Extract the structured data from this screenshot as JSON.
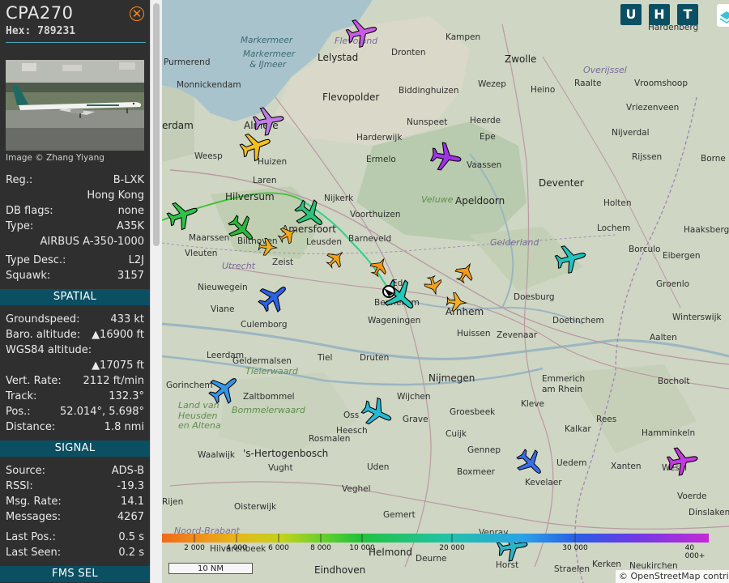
{
  "aircraft": {
    "callsign": "CPA270",
    "hex_label": "Hex:",
    "hex": "789231",
    "image_credit": "Image © Zhang Yiyang"
  },
  "details": [
    {
      "label": "Reg.:",
      "value": "B-LXK"
    },
    {
      "label": "",
      "value": "Hong Kong"
    },
    {
      "label": "DB flags:",
      "value": "none"
    },
    {
      "label": "Type:",
      "value": "A35K"
    },
    {
      "label": "",
      "value": "AIRBUS A-350-1000"
    },
    {
      "label": "Type Desc.:",
      "value": "L2J"
    },
    {
      "label": "Squawk:",
      "value": "3157"
    }
  ],
  "sections": {
    "spatial": "SPATIAL",
    "signal": "SIGNAL",
    "fms": "FMS SEL"
  },
  "spatial": [
    {
      "label": "Groundspeed:",
      "value": "433 kt"
    },
    {
      "label": "Baro. altitude:",
      "value": "▲16900 ft"
    },
    {
      "label": "WGS84 altitude:",
      "value": ""
    },
    {
      "label": "",
      "value": "▲17075 ft"
    },
    {
      "label": "Vert. Rate:",
      "value": "2112 ft/min"
    },
    {
      "label": "Track:",
      "value": "132.3°"
    },
    {
      "label": "Pos.:",
      "value": "52.014°, 5.698°"
    },
    {
      "label": "Distance:",
      "value": "1.8 nmi"
    }
  ],
  "signal": [
    {
      "label": "Source:",
      "value": "ADS-B"
    },
    {
      "label": "RSSI:",
      "value": "-19.3"
    },
    {
      "label": "Msg. Rate:",
      "value": "14.1"
    },
    {
      "label": "Messages:",
      "value": "4267"
    },
    {
      "label": "Last Pos.:",
      "value": "0.5 s"
    },
    {
      "label": "Last Seen:",
      "value": "0.2 s"
    }
  ],
  "map_controls": {
    "u": "U",
    "h": "H",
    "t": "T",
    "layer_icon": "layers-icon"
  },
  "altitude_legend": [
    "2 000",
    "4 000",
    "6 000",
    "8 000",
    "10 000",
    "20 000",
    "30 000",
    "40 000+"
  ],
  "scale_label": "10 NM",
  "attribution": "© OpenStreetMap contributors",
  "places": [
    {
      "name": "Markermeer",
      "kind": "water"
    },
    {
      "name": "Markermeer",
      "kind": "water"
    },
    {
      "name": "& IJmeer",
      "kind": "water"
    },
    {
      "name": "Flevoland",
      "kind": "prov"
    },
    {
      "name": "Lelystad",
      "kind": "town"
    },
    {
      "name": "Kampen",
      "kind": "town"
    },
    {
      "name": "Hardenberg",
      "kind": "town"
    },
    {
      "name": "Dronten",
      "kind": "town"
    },
    {
      "name": "Zwolle",
      "kind": "city"
    },
    {
      "name": "Overijssel",
      "kind": "prov"
    },
    {
      "name": "Purmerend",
      "kind": "town"
    },
    {
      "name": "Monnickendam",
      "kind": "town"
    },
    {
      "name": "Flevopolder",
      "kind": "city"
    },
    {
      "name": "Biddinghuizen",
      "kind": "town"
    },
    {
      "name": "Wezep",
      "kind": "town"
    },
    {
      "name": "Heino",
      "kind": "town"
    },
    {
      "name": "Raalte",
      "kind": "town"
    },
    {
      "name": "Vroomshoop",
      "kind": "town"
    },
    {
      "name": "Vriezenveen",
      "kind": "town"
    },
    {
      "name": "Nijverdal",
      "kind": "town"
    },
    {
      "name": "Rijssen",
      "kind": "town"
    },
    {
      "name": "Borne",
      "kind": "town"
    },
    {
      "name": "erdam",
      "kind": "city"
    },
    {
      "name": "Almere",
      "kind": "city"
    },
    {
      "name": "Nunspeet",
      "kind": "town"
    },
    {
      "name": "Epe",
      "kind": "town"
    },
    {
      "name": "Harderwijk",
      "kind": "town"
    },
    {
      "name": "Heerde",
      "kind": "town"
    },
    {
      "name": "Weesp",
      "kind": "town"
    },
    {
      "name": "Huizen",
      "kind": "town"
    },
    {
      "name": "Ermelo",
      "kind": "town"
    },
    {
      "name": "Vaassen",
      "kind": "town"
    },
    {
      "name": "Laren",
      "kind": "town"
    },
    {
      "name": "Veluwe",
      "kind": "region"
    },
    {
      "name": "Apeldoorn",
      "kind": "city"
    },
    {
      "name": "Deventer",
      "kind": "city"
    },
    {
      "name": "Hilversum",
      "kind": "city"
    },
    {
      "name": "Nijkerk",
      "kind": "town"
    },
    {
      "name": "Holten",
      "kind": "town"
    },
    {
      "name": "Voorthuizen",
      "kind": "town"
    },
    {
      "name": "Maarssen",
      "kind": "town"
    },
    {
      "name": "Bilthoven",
      "kind": "town"
    },
    {
      "name": "Amersfoort",
      "kind": "city"
    },
    {
      "name": "Leusden",
      "kind": "town"
    },
    {
      "name": "Barneveld",
      "kind": "town"
    },
    {
      "name": "Gelderland",
      "kind": "prov"
    },
    {
      "name": "Lochem",
      "kind": "town"
    },
    {
      "name": "Haaksbergen",
      "kind": "town"
    },
    {
      "name": "Vleuten",
      "kind": "town"
    },
    {
      "name": "Utrecht",
      "kind": "prov"
    },
    {
      "name": "Zeist",
      "kind": "town"
    },
    {
      "name": "Borculo",
      "kind": "town"
    },
    {
      "name": "Eibergen",
      "kind": "town"
    },
    {
      "name": "Nieuwegein",
      "kind": "town"
    },
    {
      "name": "Ede",
      "kind": "town"
    },
    {
      "name": "Bennekom",
      "kind": "town"
    },
    {
      "name": "Groenlo",
      "kind": "town"
    },
    {
      "name": "Viane",
      "kind": "town"
    },
    {
      "name": "Doesburg",
      "kind": "town"
    },
    {
      "name": "Arnhem",
      "kind": "city"
    },
    {
      "name": "Culemborg",
      "kind": "town"
    },
    {
      "name": "Wageningen",
      "kind": "town"
    },
    {
      "name": "Huissen",
      "kind": "town"
    },
    {
      "name": "Zevenaar",
      "kind": "town"
    },
    {
      "name": "Doetinchem",
      "kind": "town"
    },
    {
      "name": "Winterswijk",
      "kind": "town"
    },
    {
      "name": "Leerdam",
      "kind": "town"
    },
    {
      "name": "Tiel",
      "kind": "town"
    },
    {
      "name": "Druten",
      "kind": "town"
    },
    {
      "name": "Aalten",
      "kind": "town"
    },
    {
      "name": "Geldermalsen",
      "kind": "town"
    },
    {
      "name": "Tielerwaard",
      "kind": "region"
    },
    {
      "name": "Nijmegen",
      "kind": "city"
    },
    {
      "name": "Emmerich",
      "kind": "town"
    },
    {
      "name": "am Rhein",
      "kind": "town"
    },
    {
      "name": "Gorinchem",
      "kind": "town"
    },
    {
      "name": "Bocholt",
      "kind": "town"
    },
    {
      "name": "Zaltbommel",
      "kind": "town"
    },
    {
      "name": "Wijchen",
      "kind": "town"
    },
    {
      "name": "Land van",
      "kind": "region"
    },
    {
      "name": "Heusden",
      "kind": "region"
    },
    {
      "name": "en Altena",
      "kind": "region"
    },
    {
      "name": "Bommelerwaard",
      "kind": "region"
    },
    {
      "name": "Kleve",
      "kind": "town"
    },
    {
      "name": "Oss",
      "kind": "town"
    },
    {
      "name": "Grave",
      "kind": "town"
    },
    {
      "name": "Groesbeek",
      "kind": "town"
    },
    {
      "name": "Kalkar",
      "kind": "town"
    },
    {
      "name": "Rees",
      "kind": "town"
    },
    {
      "name": "Heesch",
      "kind": "town"
    },
    {
      "name": "Cuijk",
      "kind": "town"
    },
    {
      "name": "Hamminkeln",
      "kind": "town"
    },
    {
      "name": "Waalwijk",
      "kind": "town"
    },
    {
      "name": "'s-Hertogenbosch",
      "kind": "city"
    },
    {
      "name": "Rosmalen",
      "kind": "town"
    },
    {
      "name": "Gennep",
      "kind": "town"
    },
    {
      "name": "Uedem",
      "kind": "town"
    },
    {
      "name": "Vught",
      "kind": "town"
    },
    {
      "name": "Uden",
      "kind": "town"
    },
    {
      "name": "Boxmeer",
      "kind": "town"
    },
    {
      "name": "Xanten",
      "kind": "town"
    },
    {
      "name": "Wesel",
      "kind": "town"
    },
    {
      "name": "Veghel",
      "kind": "town"
    },
    {
      "name": "Kevelaer",
      "kind": "town"
    },
    {
      "name": "Voerde",
      "kind": "town"
    },
    {
      "name": "Rijen",
      "kind": "town"
    },
    {
      "name": "Oisterwijk",
      "kind": "town"
    },
    {
      "name": "Gemert",
      "kind": "town"
    },
    {
      "name": "Dinslaken",
      "kind": "town"
    },
    {
      "name": "Noord-Brabant",
      "kind": "prov"
    },
    {
      "name": "Hilvarenbeek",
      "kind": "town"
    },
    {
      "name": "Helmond",
      "kind": "city"
    },
    {
      "name": "Venray",
      "kind": "town"
    },
    {
      "name": "Eindhoven",
      "kind": "city"
    },
    {
      "name": "Deurne",
      "kind": "town"
    },
    {
      "name": "Horst",
      "kind": "town"
    },
    {
      "name": "Straelen",
      "kind": "town"
    },
    {
      "name": "Kerken",
      "kind": "town"
    },
    {
      "name": "Neukirchen",
      "kind": "town"
    }
  ],
  "colors": {
    "section_bg": "#0b4f63",
    "sidebar_bg": "#2f2f2f",
    "close_accent": "#ff8a1a"
  }
}
